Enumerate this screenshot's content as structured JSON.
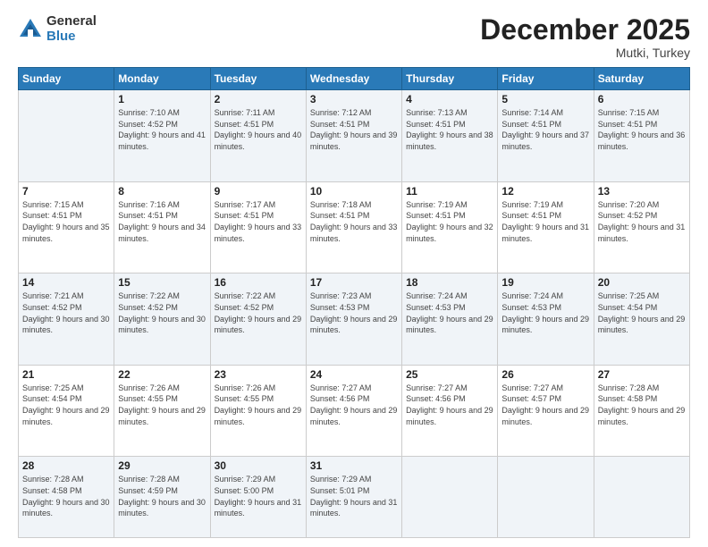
{
  "logo": {
    "general": "General",
    "blue": "Blue"
  },
  "header": {
    "month": "December 2025",
    "location": "Mutki, Turkey"
  },
  "weekdays": [
    "Sunday",
    "Monday",
    "Tuesday",
    "Wednesday",
    "Thursday",
    "Friday",
    "Saturday"
  ],
  "rows": [
    [
      {
        "num": "",
        "sunrise": "",
        "sunset": "",
        "daylight": ""
      },
      {
        "num": "1",
        "sunrise": "Sunrise: 7:10 AM",
        "sunset": "Sunset: 4:52 PM",
        "daylight": "Daylight: 9 hours and 41 minutes."
      },
      {
        "num": "2",
        "sunrise": "Sunrise: 7:11 AM",
        "sunset": "Sunset: 4:51 PM",
        "daylight": "Daylight: 9 hours and 40 minutes."
      },
      {
        "num": "3",
        "sunrise": "Sunrise: 7:12 AM",
        "sunset": "Sunset: 4:51 PM",
        "daylight": "Daylight: 9 hours and 39 minutes."
      },
      {
        "num": "4",
        "sunrise": "Sunrise: 7:13 AM",
        "sunset": "Sunset: 4:51 PM",
        "daylight": "Daylight: 9 hours and 38 minutes."
      },
      {
        "num": "5",
        "sunrise": "Sunrise: 7:14 AM",
        "sunset": "Sunset: 4:51 PM",
        "daylight": "Daylight: 9 hours and 37 minutes."
      },
      {
        "num": "6",
        "sunrise": "Sunrise: 7:15 AM",
        "sunset": "Sunset: 4:51 PM",
        "daylight": "Daylight: 9 hours and 36 minutes."
      }
    ],
    [
      {
        "num": "7",
        "sunrise": "Sunrise: 7:15 AM",
        "sunset": "Sunset: 4:51 PM",
        "daylight": "Daylight: 9 hours and 35 minutes."
      },
      {
        "num": "8",
        "sunrise": "Sunrise: 7:16 AM",
        "sunset": "Sunset: 4:51 PM",
        "daylight": "Daylight: 9 hours and 34 minutes."
      },
      {
        "num": "9",
        "sunrise": "Sunrise: 7:17 AM",
        "sunset": "Sunset: 4:51 PM",
        "daylight": "Daylight: 9 hours and 33 minutes."
      },
      {
        "num": "10",
        "sunrise": "Sunrise: 7:18 AM",
        "sunset": "Sunset: 4:51 PM",
        "daylight": "Daylight: 9 hours and 33 minutes."
      },
      {
        "num": "11",
        "sunrise": "Sunrise: 7:19 AM",
        "sunset": "Sunset: 4:51 PM",
        "daylight": "Daylight: 9 hours and 32 minutes."
      },
      {
        "num": "12",
        "sunrise": "Sunrise: 7:19 AM",
        "sunset": "Sunset: 4:51 PM",
        "daylight": "Daylight: 9 hours and 31 minutes."
      },
      {
        "num": "13",
        "sunrise": "Sunrise: 7:20 AM",
        "sunset": "Sunset: 4:52 PM",
        "daylight": "Daylight: 9 hours and 31 minutes."
      }
    ],
    [
      {
        "num": "14",
        "sunrise": "Sunrise: 7:21 AM",
        "sunset": "Sunset: 4:52 PM",
        "daylight": "Daylight: 9 hours and 30 minutes."
      },
      {
        "num": "15",
        "sunrise": "Sunrise: 7:22 AM",
        "sunset": "Sunset: 4:52 PM",
        "daylight": "Daylight: 9 hours and 30 minutes."
      },
      {
        "num": "16",
        "sunrise": "Sunrise: 7:22 AM",
        "sunset": "Sunset: 4:52 PM",
        "daylight": "Daylight: 9 hours and 29 minutes."
      },
      {
        "num": "17",
        "sunrise": "Sunrise: 7:23 AM",
        "sunset": "Sunset: 4:53 PM",
        "daylight": "Daylight: 9 hours and 29 minutes."
      },
      {
        "num": "18",
        "sunrise": "Sunrise: 7:24 AM",
        "sunset": "Sunset: 4:53 PM",
        "daylight": "Daylight: 9 hours and 29 minutes."
      },
      {
        "num": "19",
        "sunrise": "Sunrise: 7:24 AM",
        "sunset": "Sunset: 4:53 PM",
        "daylight": "Daylight: 9 hours and 29 minutes."
      },
      {
        "num": "20",
        "sunrise": "Sunrise: 7:25 AM",
        "sunset": "Sunset: 4:54 PM",
        "daylight": "Daylight: 9 hours and 29 minutes."
      }
    ],
    [
      {
        "num": "21",
        "sunrise": "Sunrise: 7:25 AM",
        "sunset": "Sunset: 4:54 PM",
        "daylight": "Daylight: 9 hours and 29 minutes."
      },
      {
        "num": "22",
        "sunrise": "Sunrise: 7:26 AM",
        "sunset": "Sunset: 4:55 PM",
        "daylight": "Daylight: 9 hours and 29 minutes."
      },
      {
        "num": "23",
        "sunrise": "Sunrise: 7:26 AM",
        "sunset": "Sunset: 4:55 PM",
        "daylight": "Daylight: 9 hours and 29 minutes."
      },
      {
        "num": "24",
        "sunrise": "Sunrise: 7:27 AM",
        "sunset": "Sunset: 4:56 PM",
        "daylight": "Daylight: 9 hours and 29 minutes."
      },
      {
        "num": "25",
        "sunrise": "Sunrise: 7:27 AM",
        "sunset": "Sunset: 4:56 PM",
        "daylight": "Daylight: 9 hours and 29 minutes."
      },
      {
        "num": "26",
        "sunrise": "Sunrise: 7:27 AM",
        "sunset": "Sunset: 4:57 PM",
        "daylight": "Daylight: 9 hours and 29 minutes."
      },
      {
        "num": "27",
        "sunrise": "Sunrise: 7:28 AM",
        "sunset": "Sunset: 4:58 PM",
        "daylight": "Daylight: 9 hours and 29 minutes."
      }
    ],
    [
      {
        "num": "28",
        "sunrise": "Sunrise: 7:28 AM",
        "sunset": "Sunset: 4:58 PM",
        "daylight": "Daylight: 9 hours and 30 minutes."
      },
      {
        "num": "29",
        "sunrise": "Sunrise: 7:28 AM",
        "sunset": "Sunset: 4:59 PM",
        "daylight": "Daylight: 9 hours and 30 minutes."
      },
      {
        "num": "30",
        "sunrise": "Sunrise: 7:29 AM",
        "sunset": "Sunset: 5:00 PM",
        "daylight": "Daylight: 9 hours and 31 minutes."
      },
      {
        "num": "31",
        "sunrise": "Sunrise: 7:29 AM",
        "sunset": "Sunset: 5:01 PM",
        "daylight": "Daylight: 9 hours and 31 minutes."
      },
      {
        "num": "",
        "sunrise": "",
        "sunset": "",
        "daylight": ""
      },
      {
        "num": "",
        "sunrise": "",
        "sunset": "",
        "daylight": ""
      },
      {
        "num": "",
        "sunrise": "",
        "sunset": "",
        "daylight": ""
      }
    ]
  ]
}
